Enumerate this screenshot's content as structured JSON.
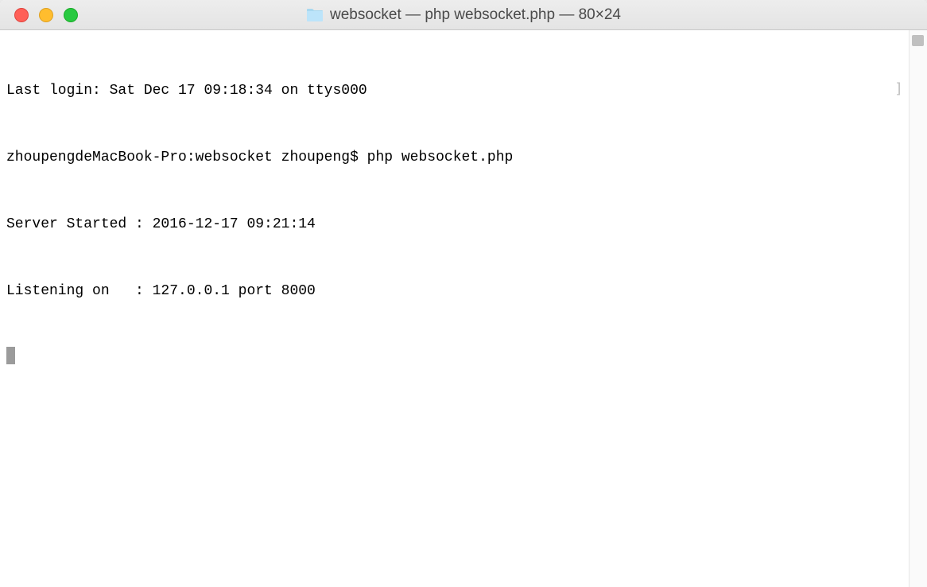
{
  "window": {
    "title": "websocket — php websocket.php — 80×24"
  },
  "terminal": {
    "lines": [
      "Last login: Sat Dec 17 09:18:34 on ttys000",
      "zhoupengdeMacBook-Pro:websocket zhoupeng$ php websocket.php",
      "Server Started : 2016-12-17 09:21:14",
      "Listening on   : 127.0.0.1 port 8000"
    ]
  }
}
